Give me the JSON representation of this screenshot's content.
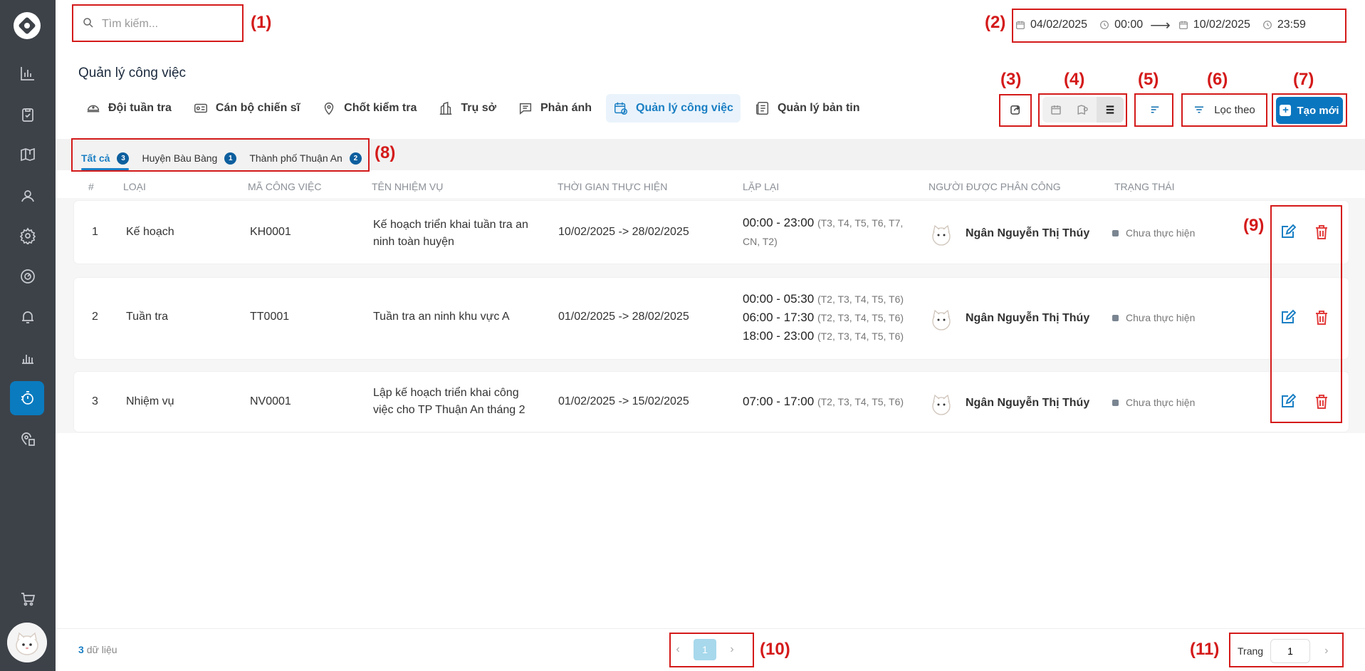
{
  "search": {
    "placeholder": "Tìm kiếm..."
  },
  "date_range": {
    "start_date": "04/02/2025",
    "start_time": "00:00",
    "arrow": "⟶",
    "end_date": "10/02/2025",
    "end_time": "23:59"
  },
  "page_title": "Quản lý công việc",
  "tabs": [
    {
      "label": "Đội tuần tra",
      "icon": "patrol-hat-icon"
    },
    {
      "label": "Cán bộ chiến sĩ",
      "icon": "id-card-icon"
    },
    {
      "label": "Chốt kiểm tra",
      "icon": "location-pin-icon"
    },
    {
      "label": "Trụ sở",
      "icon": "building-icon"
    },
    {
      "label": "Phản ánh",
      "icon": "chat-icon"
    },
    {
      "label": "Quản lý công việc",
      "icon": "calendar-clock-icon",
      "active": true
    },
    {
      "label": "Quản lý bản tin",
      "icon": "newspaper-icon"
    }
  ],
  "toolbar": {
    "filter_label": "Lọc theo",
    "create_label": "Tạo mới"
  },
  "regions": [
    {
      "label": "Tất cả",
      "count": "3",
      "active": true
    },
    {
      "label": "Huyện Bàu Bàng",
      "count": "1"
    },
    {
      "label": "Thành phố Thuận An",
      "count": "2"
    }
  ],
  "table": {
    "headers": [
      "#",
      "LOẠI",
      "MÃ CÔNG VIỆC",
      "TÊN NHIỆM VỤ",
      "THỜI GIAN THỰC HIỆN",
      "LẶP LẠI",
      "NGƯỜI ĐƯỢC PHÂN CÔNG",
      "TRẠNG THÁI"
    ],
    "rows": [
      {
        "index": "1",
        "type": "Kế hoạch",
        "code": "KH0001",
        "name_l1": "Kế hoạch triển khai tuần tra an",
        "name_l2": "ninh toàn huyện",
        "period": "10/02/2025 -> 28/02/2025",
        "repeat": [
          {
            "time": "00:00 - 23:00",
            "days": "(T3, T4, T5, T6, T7,",
            "days2": "CN, T2)"
          }
        ],
        "assignee": "Ngân Nguyễn Thị Thúy",
        "status": "Chưa thực hiện"
      },
      {
        "index": "2",
        "type": "Tuần tra",
        "code": "TT0001",
        "name_l1": "Tuần tra an ninh khu vực A",
        "name_l2": "",
        "period": "01/02/2025 -> 28/02/2025",
        "repeat": [
          {
            "time": "00:00 - 05:30",
            "days": "(T2, T3, T4, T5, T6)"
          },
          {
            "time": "06:00 - 17:30",
            "days": "(T2, T3, T4, T5, T6)"
          },
          {
            "time": "18:00 - 23:00",
            "days": "(T2, T3, T4, T5, T6)"
          }
        ],
        "assignee": "Ngân Nguyễn Thị Thúy",
        "status": "Chưa thực hiện"
      },
      {
        "index": "3",
        "type": "Nhiệm vụ",
        "code": "NV0001",
        "name_l1": "Lập kế hoạch triển khai công",
        "name_l2": "việc cho TP Thuận An tháng 2",
        "period": "01/02/2025 -> 15/02/2025",
        "repeat": [
          {
            "time": "07:00 - 17:00",
            "days": "(T2, T3, T4, T5, T6)"
          }
        ],
        "assignee": "Ngân Nguyễn Thị Thúy",
        "status": "Chưa thực hiện"
      }
    ]
  },
  "footer": {
    "count": "3",
    "count_label": "dữ liệu",
    "current_page": "1",
    "goto_label": "Trang",
    "goto_value": "1"
  },
  "annotations": [
    "(1)",
    "(2)",
    "(3)",
    "(4)",
    "(5)",
    "(6)",
    "(7)",
    "(8)",
    "(9)",
    "(10)",
    "(11)"
  ],
  "colors": {
    "sidebar": "#3d4249",
    "accent": "#0a76bf",
    "annotation": "#d41a1a",
    "delete": "#e23c3c"
  }
}
